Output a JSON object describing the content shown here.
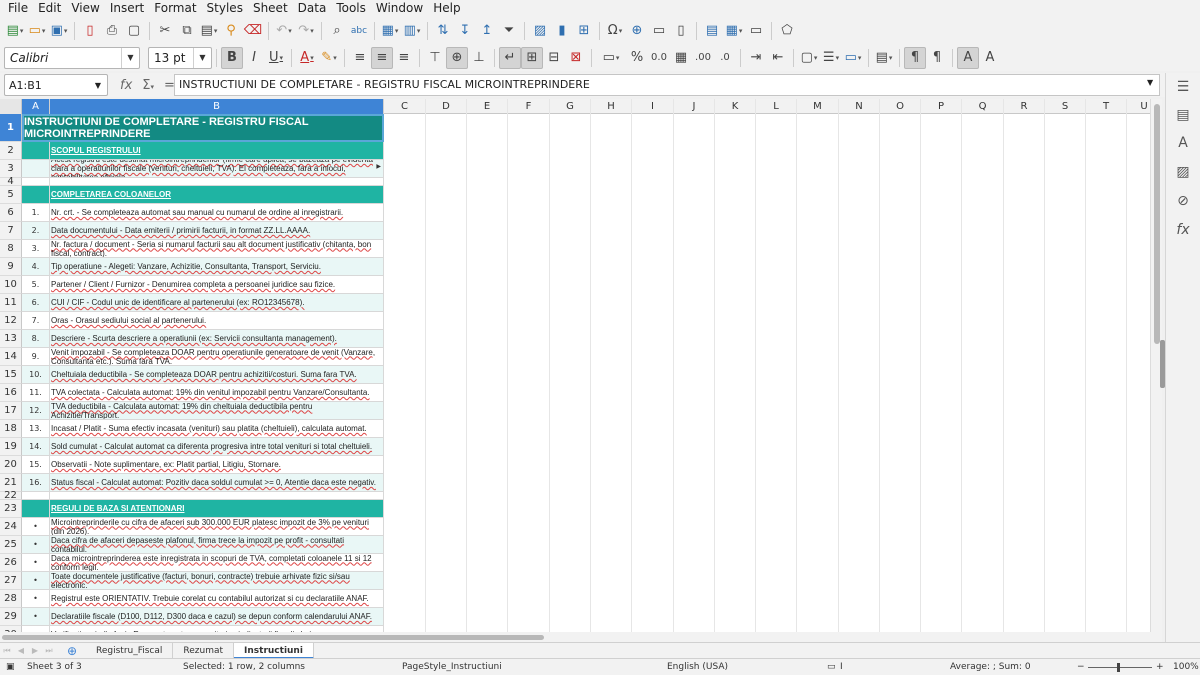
{
  "menu": [
    "File",
    "Edit",
    "View",
    "Insert",
    "Format",
    "Styles",
    "Sheet",
    "Data",
    "Tools",
    "Window",
    "Help"
  ],
  "font": {
    "name": "Calibri",
    "size": "13 pt"
  },
  "formula_bar": {
    "cell_ref": "A1:B1",
    "content": "INSTRUCTIUNI DE COMPLETARE - REGISTRU FISCAL MICROINTREPRINDERE"
  },
  "columns": [
    "A",
    "B",
    "C",
    "D",
    "E",
    "F",
    "G",
    "H",
    "I",
    "J",
    "K",
    "L",
    "M",
    "N",
    "O",
    "P",
    "Q",
    "R",
    "S",
    "T",
    "U"
  ],
  "rows": [
    {
      "num": "1",
      "type": "title",
      "b": "INSTRUCTIUNI DE COMPLETARE - REGISTRU FISCAL MICROINTREPRINDERE"
    },
    {
      "num": "2",
      "type": "section",
      "a": "",
      "b": "SCOPUL REGISTRULUI"
    },
    {
      "num": "3",
      "type": "alt",
      "a": "",
      "b": "Acest registru este destinat microintreprinderilor (firme care aplica, se bazeaza pe evidenta clara a operatiunilor fiscale (venituri, cheltuieli, TVA). El completeaza, fara a inlocui, contabilitatea oficiala."
    },
    {
      "num": "4",
      "type": "plain",
      "a": "",
      "b": ""
    },
    {
      "num": "5",
      "type": "section",
      "a": "",
      "b": "COMPLETAREA COLOANELOR"
    },
    {
      "num": "6",
      "type": "plain",
      "a": "1.",
      "b": "Nr. crt. - Se completeaza automat sau manual cu numarul de ordine al inregistrarii."
    },
    {
      "num": "7",
      "type": "alt",
      "a": "2.",
      "b": "Data documentului - Data emiterii / primirii facturii, in format ZZ.LL.AAAA."
    },
    {
      "num": "8",
      "type": "plain",
      "a": "3.",
      "b": "Nr. factura / document - Seria si numarul facturii sau alt document justificativ (chitanta, bon fiscal, contract)."
    },
    {
      "num": "9",
      "type": "alt",
      "a": "4.",
      "b": "Tip operatiune - Alegeti: Vanzare, Achizitie, Consultanta, Transport, Serviciu."
    },
    {
      "num": "10",
      "type": "plain",
      "a": "5.",
      "b": "Partener / Client / Furnizor - Denumirea completa a persoanei juridice sau fizice."
    },
    {
      "num": "11",
      "type": "alt",
      "a": "6.",
      "b": "CUI / CIF - Codul unic de identificare al partenerului (ex: RO12345678)."
    },
    {
      "num": "12",
      "type": "plain",
      "a": "7.",
      "b": "Oras - Orasul sediului social al partenerului."
    },
    {
      "num": "13",
      "type": "alt",
      "a": "8.",
      "b": "Descriere - Scurta descriere a operatiunii (ex: Servicii consultanta management)."
    },
    {
      "num": "14",
      "type": "plain",
      "a": "9.",
      "b": "Venit impozabil - Se completeaza DOAR pentru operatiunile generatoare de venit (Vanzare, Consultanta etc.). Suma fara TVA."
    },
    {
      "num": "15",
      "type": "alt",
      "a": "10.",
      "b": "Cheltuiala deductibila - Se completeaza DOAR pentru achizitii/costuri. Suma fara TVA."
    },
    {
      "num": "16",
      "type": "plain",
      "a": "11.",
      "b": "TVA colectata - Calculata automat: 19% din venitul impozabil pentru Vanzare/Consultanta."
    },
    {
      "num": "17",
      "type": "alt",
      "a": "12.",
      "b": "TVA deductibila - Calculata automat: 19% din cheltuiala deductibila pentru Achizitie/Transport."
    },
    {
      "num": "18",
      "type": "plain",
      "a": "13.",
      "b": "Incasat / Platit - Suma efectiv incasata (venituri) sau platita (cheltuieli), calculata automat."
    },
    {
      "num": "19",
      "type": "alt",
      "a": "14.",
      "b": "Sold cumulat - Calculat automat ca diferenta progresiva intre total venituri si total cheltuieli."
    },
    {
      "num": "20",
      "type": "plain",
      "a": "15.",
      "b": "Observatii - Note suplimentare, ex: Platit partial, Litigiu, Stornare."
    },
    {
      "num": "21",
      "type": "alt",
      "a": "16.",
      "b": "Status fiscal - Calculat automat: Pozitiv daca soldul cumulat >= 0, Atentie daca este negativ."
    },
    {
      "num": "22",
      "type": "plain",
      "a": "",
      "b": ""
    },
    {
      "num": "23",
      "type": "section",
      "a": "",
      "b": "REGULI DE BAZA SI ATENTIONARI"
    },
    {
      "num": "24",
      "type": "plain",
      "a": "•",
      "b": "Microintreprinderile cu cifra de afaceri sub 300.000 EUR platesc impozit de 3% pe venituri (din 2026)."
    },
    {
      "num": "25",
      "type": "alt",
      "a": "•",
      "b": "Daca cifra de afaceri depaseste plafonul, firma trece la impozit pe profit - consultati contabilul."
    },
    {
      "num": "26",
      "type": "plain",
      "a": "•",
      "b": "Daca microintreprinderea este inregistrata in scopuri de TVA, completati coloanele 11 si 12 conform legii."
    },
    {
      "num": "27",
      "type": "alt",
      "a": "•",
      "b": "Toate documentele justificative (facturi, bonuri, contracte) trebuie arhivate fizic si/sau electronic."
    },
    {
      "num": "28",
      "type": "plain",
      "a": "•",
      "b": "Registrul este ORIENTATIV. Trebuie corelat cu contabilul autorizat si cu declaratiile ANAF."
    },
    {
      "num": "29",
      "type": "alt",
      "a": "•",
      "b": "Declaratiile fiscale (D100, D112, D300 daca e cazul) se depun conform calendarului ANAF."
    },
    {
      "num": "30",
      "type": "plain",
      "a": "•",
      "b": "Verificati periodic foaia Rezumat pentru a monitoriza indicatorii fiscali cheie."
    }
  ],
  "sheet_tabs": [
    "Registru_Fiscal",
    "Rezumat",
    "Instructiuni"
  ],
  "active_tab": "Instructiuni",
  "status": {
    "sheet": "Sheet 3 of 3",
    "selection": "Selected: 1 row, 2 columns",
    "page_style": "PageStyle_Instructiuni",
    "language": "English (USA)",
    "summary": "Average: ; Sum: 0",
    "zoom": "100%"
  },
  "colors": {
    "title_bg": "#138a83",
    "section_bg": "#1fb4a3",
    "alt_row_bg": "#e9f7f6",
    "selection": "#3e84d6"
  }
}
